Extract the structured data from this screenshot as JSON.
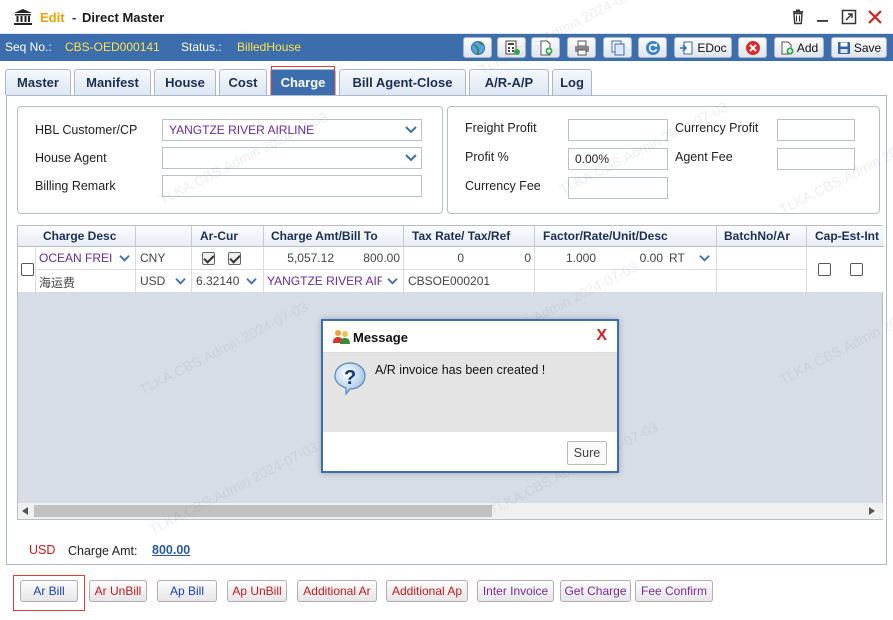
{
  "window": {
    "mode": "Edit",
    "separator": "-",
    "title": "Direct Master",
    "seq_label": "Seq No.:",
    "seq_value": "CBS-OED000141",
    "status_label": "Status.:",
    "status_value": "BilledHouse"
  },
  "toolbar": {
    "edoc_label": "EDoc",
    "add_label": "Add",
    "save_label": "Save"
  },
  "tabs": [
    "Master",
    "Manifest",
    "House",
    "Cost",
    "Charge",
    "Bill Agent-Close",
    "A/R-A/P",
    "Log"
  ],
  "active_tab": "Charge",
  "form": {
    "hbl_customer_label": "HBL Customer/CP",
    "hbl_customer_value": "YANGTZE RIVER AIRLINE",
    "house_agent_label": "House Agent",
    "house_agent_value": "",
    "billing_remark_label": "Billing Remark",
    "billing_remark_value": "",
    "freight_profit_label": "Freight Profit",
    "freight_profit_value": "",
    "profit_pct_label": "Profit %",
    "profit_pct_value": "0.00%",
    "currency_fee_label": "Currency Fee",
    "currency_fee_value": "",
    "currency_profit_label": "Currency Profit",
    "currency_profit_value": "",
    "agent_fee_label": "Agent Fee",
    "agent_fee_value": ""
  },
  "grid": {
    "headers": {
      "charge_desc": "Charge Desc",
      "ar_cur": "Ar-Cur",
      "charge_amt": "Charge Amt/Bill To",
      "tax_rate": "Tax Rate/ Tax/Ref",
      "factor": "Factor/Rate/Unit/Desc",
      "batch": "BatchNo/Ar",
      "cap": "Cap-Est-Int"
    },
    "row": {
      "charge_code": "OCEAN FREI",
      "charge_name": "海运费",
      "currency": "CNY",
      "ar_currency": "USD",
      "exchange_rate": "6.32140",
      "amount": "5,057.12",
      "bill_amount": "800.00",
      "bill_to": "YANGTZE RIVER AIF",
      "tax_rate": "0",
      "tax": "0",
      "reference": "CBSOE000201",
      "factor": "1.000",
      "rate": "0.00",
      "unit": "RT"
    }
  },
  "summary": {
    "currency": "USD",
    "charge_amt_label": "Charge Amt:",
    "charge_amt_value": "800.00"
  },
  "buttons": [
    {
      "label": "Ar Bill",
      "color": "#1a3fbf"
    },
    {
      "label": "Ar UnBill",
      "color": "#c71a1a"
    },
    {
      "label": "Ap Bill",
      "color": "#1a3fbf"
    },
    {
      "label": "Ap UnBill",
      "color": "#c71a1a"
    },
    {
      "label": "Additional Ar",
      "color": "#c71a1a"
    },
    {
      "label": "Additional Ap",
      "color": "#c71a1a"
    },
    {
      "label": "Inter Invoice",
      "color": "#7a2a9a"
    },
    {
      "label": "Get Charge",
      "color": "#7a2a9a"
    },
    {
      "label": "Fee Confirm",
      "color": "#7a2a9a"
    }
  ],
  "dialog": {
    "title": "Message",
    "message": "A/R invoice has been created !",
    "ok_label": "Sure"
  },
  "watermark": "TLKA.CBS.Admin 2024-07-03",
  "colors": {
    "header_blue": "#3c6ead",
    "status_yellow": "#ffe14a",
    "edit_orange": "#f0a000",
    "close_red": "#d51f1f"
  }
}
